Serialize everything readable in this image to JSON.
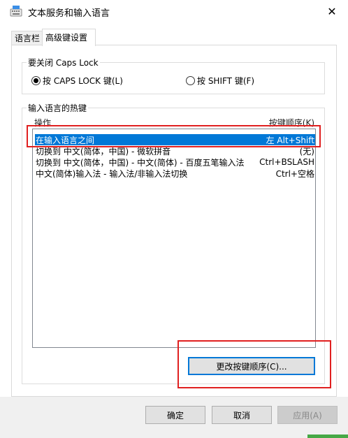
{
  "window": {
    "title": "文本服务和输入语言",
    "close_glyph": "✕"
  },
  "tabs": [
    {
      "label": "语言栏"
    },
    {
      "label": "高级键设置"
    }
  ],
  "caps_lock": {
    "title": "要关闭 Caps Lock",
    "option_capslock": "按 CAPS LOCK 键(L)",
    "option_shift": "按 SHIFT 键(F)",
    "selected": "capslock"
  },
  "hotkeys": {
    "title": "输入语言的热键",
    "col_action": "操作",
    "col_sequence": "按键顺序(K)",
    "rows": [
      {
        "action": "在输入语言之间",
        "keys": "左 Alt+Shift",
        "selected": true
      },
      {
        "action": "切换到 中文(简体，中国) - 微软拼音",
        "keys": "(无)"
      },
      {
        "action": "切换到 中文(简体，中国) - 中文(简体) - 百度五笔输入法",
        "keys": "Ctrl+BSLASH"
      },
      {
        "action": "中文(简体)输入法 - 输入法/非输入法切换",
        "keys": "Ctrl+空格"
      }
    ],
    "change_button": "更改按键顺序(C)..."
  },
  "footer": {
    "ok": "确定",
    "cancel": "取消",
    "apply": "应用(A)"
  },
  "colors": {
    "selection": "#0078d7",
    "highlight_box": "#e02020"
  }
}
